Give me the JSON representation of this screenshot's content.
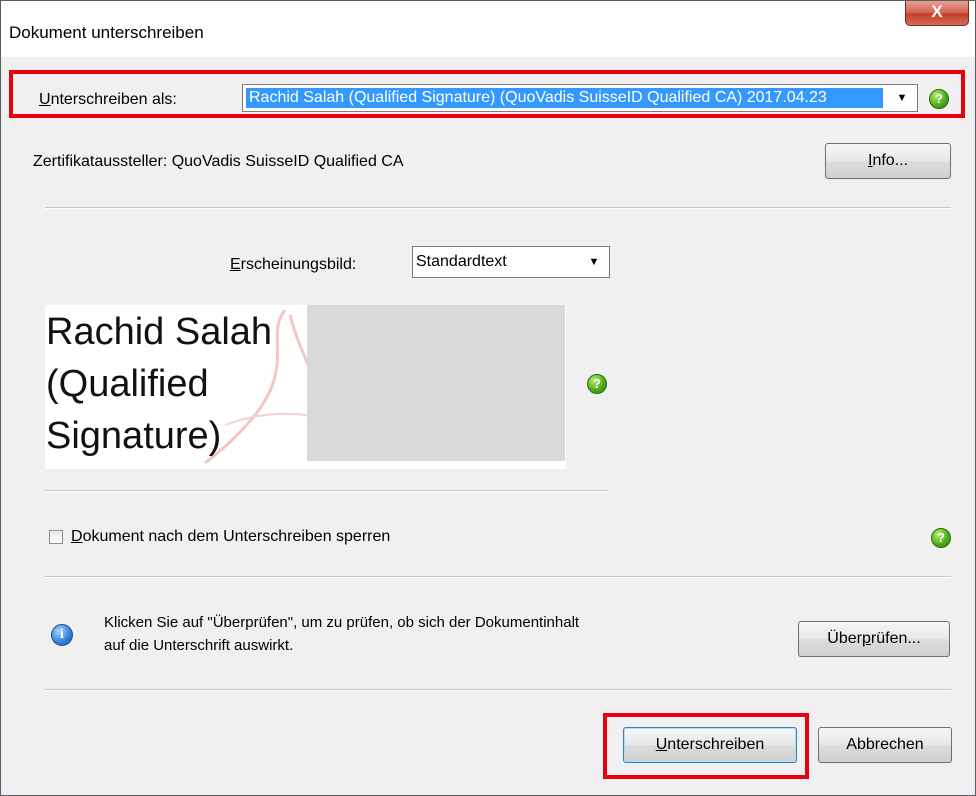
{
  "window": {
    "title": "Dokument unterschreiben",
    "close_label": "X"
  },
  "sign_as": {
    "label_accel": "U",
    "label_rest": "nterschreiben als:",
    "selected_value": "Rachid Salah (Qualified Signature) (QuoVadis SuisseID Qualified CA) 2017.04.23",
    "help": "?"
  },
  "issuer": {
    "text": "Zertifikataussteller: QuoVadis SuisseID Qualified CA",
    "info_accel": "I",
    "info_rest": "nfo..."
  },
  "appearance": {
    "label_accel": "E",
    "label_rest": "rscheinungsbild:",
    "selected_value": "Standardtext",
    "help": "?",
    "preview_lines": [
      "Rachid Salah",
      "(Qualified",
      "Signature)"
    ]
  },
  "lock": {
    "label_accel": "D",
    "label_rest": "okument nach dem Unterschreiben sperren",
    "checked": false,
    "help": "?"
  },
  "review": {
    "info_glyph": "i",
    "message_line1": "Klicken Sie auf \"Überprüfen\", um zu prüfen, ob sich der Dokumentinhalt",
    "message_line2": "auf die Unterschrift auswirkt.",
    "button_pre": "Über",
    "button_accel": "p",
    "button_post": "rüfen..."
  },
  "footer": {
    "sign_accel": "U",
    "sign_rest": "nterschreiben",
    "cancel_label": "Abbrechen"
  },
  "colors": {
    "highlight": "#e8000d",
    "selection": "#3399ff",
    "help_green": "#4fae1c"
  }
}
